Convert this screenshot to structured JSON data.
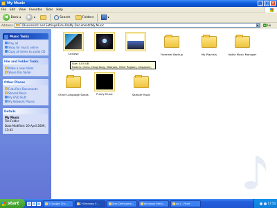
{
  "window": {
    "title": "My Music"
  },
  "menu": [
    "File",
    "Edit",
    "View",
    "Favorites",
    "Tools",
    "Help"
  ],
  "toolbar": {
    "back": "Back",
    "search": "Search",
    "folders": "Folders"
  },
  "address": {
    "label": "Address",
    "value": "C:\\Documents and Settings\\Futu-Ra\\My Documents\\My Music",
    "go": "Go"
  },
  "music_tasks": {
    "title": "Music Tasks",
    "items": [
      "Play all",
      "Shop for music online",
      "Copy all items to audio CD"
    ]
  },
  "file_tasks": {
    "title": "File and Folder Tasks",
    "items": [
      "Make a new folder",
      "Share this folder"
    ]
  },
  "other_places": {
    "title": "Other Places",
    "items": [
      "Futu-Ra's Documents",
      "Shared Music",
      "My DVD Hutt",
      "My Network Places"
    ]
  },
  "details": {
    "title": "Details",
    "name": "My Music",
    "type": "File Folder",
    "modified": "Date Modified: 20 April 2009, 13:43"
  },
  "files": [
    {
      "name": "Chinese"
    },
    {
      "name": ""
    },
    {
      "name": ""
    },
    {
      "name": "Frommer Backup"
    },
    {
      "name": "My Playlists"
    },
    {
      "name": "Nokia Music Manager"
    },
    {
      "name": "Other Language Songs"
    },
    {
      "name": "Purely Music"
    },
    {
      "name": "Sample Music"
    }
  ],
  "tooltip": {
    "size": "Size: 0.05 GB",
    "folders": "Folders: China, Hong Kong, Malaysia, Other Regions, Singapore, ..."
  },
  "taskbar": {
    "start": "start",
    "tasks": [
      "3 Google Chr...",
      "2 Windows E...",
      "Disk Defragme...",
      "Windows Medi...",
      "pic1 - Paint"
    ],
    "clock": "17:54"
  }
}
